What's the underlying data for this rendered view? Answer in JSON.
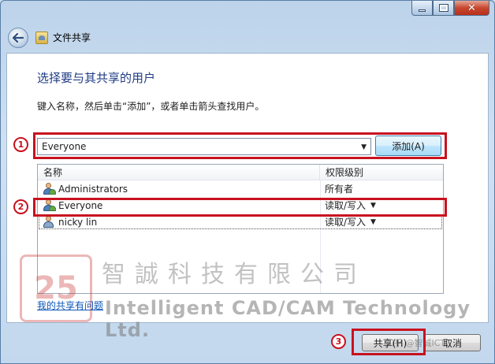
{
  "window": {
    "title": "文件共享",
    "caption_buttons": {
      "minimize": "minimize-icon",
      "maximize": "maximize-icon",
      "close": "close-icon"
    }
  },
  "page": {
    "heading": "选择要与其共享的用户",
    "instruction": "键入名称，然后单击“添加”，或者单击箭头查找用户。"
  },
  "user_combo": {
    "value": "Everyone"
  },
  "add_button": {
    "label": "添加(A)"
  },
  "list": {
    "headers": {
      "name": "名称",
      "permission": "权限级别"
    },
    "rows": [
      {
        "name": "Administrators",
        "permission": "所有者",
        "icon": "group-icon",
        "has_dropdown": false
      },
      {
        "name": "Everyone",
        "permission": "读取/写入",
        "icon": "group-icon",
        "has_dropdown": true
      },
      {
        "name": "nicky lin",
        "permission": "读取/写入",
        "icon": "user-icon",
        "has_dropdown": true
      }
    ]
  },
  "help_link": {
    "label": "我的共享有问题"
  },
  "footer": {
    "share_label": "共享(H)",
    "cancel_label": "取消"
  },
  "annotations": {
    "badge1": "1",
    "badge2": "2",
    "badge3": "3",
    "color": "#c8121f"
  },
  "watermark": {
    "logo_text": "25",
    "company_cn": "智誠科技有限公司",
    "company_en": "Intelligent CAD/CAM Technology Ltd.",
    "zhihu": "知乎 @智诚ICT"
  }
}
